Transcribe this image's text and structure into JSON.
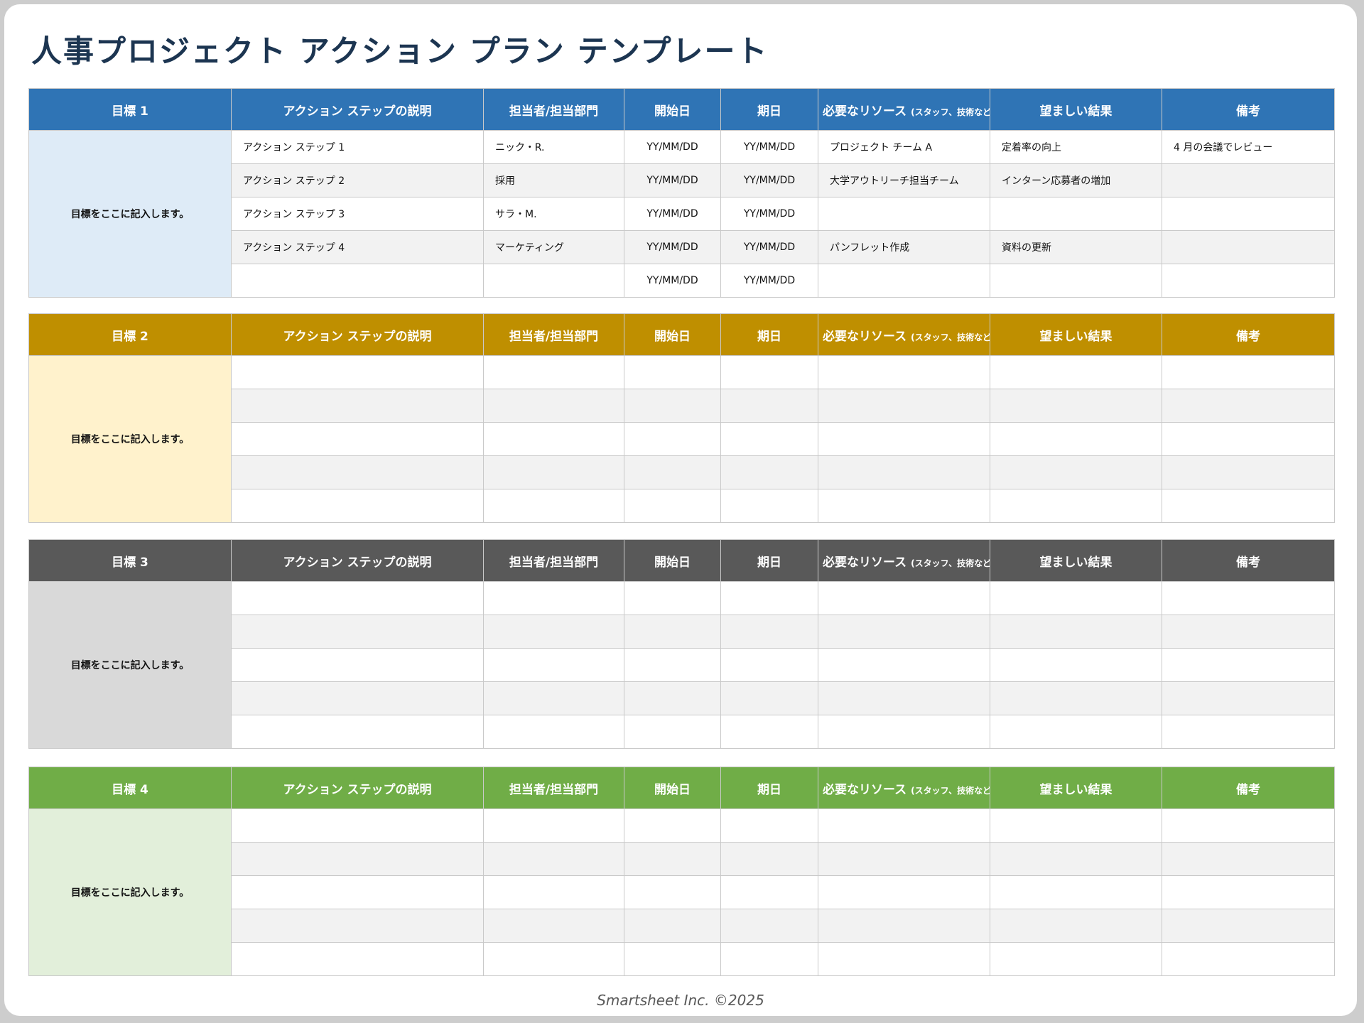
{
  "title": "人事プロジェクト アクション プラン テンプレート",
  "colors": {
    "goal1_header": "#2f74b5",
    "goal1_cell": "#deebf7",
    "goal2_header": "#bf8f00",
    "goal2_cell": "#fff2cc",
    "goal3_header": "#595959",
    "goal3_cell": "#d9d9d9",
    "goal4_header": "#70ad47",
    "goal4_cell": "#e2efda"
  },
  "headers": {
    "description": "アクション ステップの説明",
    "owner": "担当者/担当部門",
    "start": "開始日",
    "due": "期日",
    "resources": "必要なリソース",
    "resources_note": "(スタッフ、技術など)",
    "outcome": "望ましい結果",
    "notes": "備考"
  },
  "goals": [
    {
      "label": "目標 1",
      "text": "目標をここに記入します。",
      "rows": [
        {
          "description": "アクション ステップ 1",
          "owner": "ニック・R.",
          "start": "YY/MM/DD",
          "due": "YY/MM/DD",
          "resources": "プロジェクト チーム A",
          "outcome": "定着率の向上",
          "notes": "4 月の会議でレビュー"
        },
        {
          "description": "アクション ステップ 2",
          "owner": "採用",
          "start": "YY/MM/DD",
          "due": "YY/MM/DD",
          "resources": "大学アウトリーチ担当チーム",
          "outcome": "インターン応募者の増加",
          "notes": ""
        },
        {
          "description": "アクション ステップ 3",
          "owner": "サラ・M.",
          "start": "YY/MM/DD",
          "due": "YY/MM/DD",
          "resources": "",
          "outcome": "",
          "notes": ""
        },
        {
          "description": "アクション ステップ 4",
          "owner": "マーケティング",
          "start": "YY/MM/DD",
          "due": "YY/MM/DD",
          "resources": "パンフレット作成",
          "outcome": "資料の更新",
          "notes": ""
        },
        {
          "description": "",
          "owner": "",
          "start": "YY/MM/DD",
          "due": "YY/MM/DD",
          "resources": "",
          "outcome": "",
          "notes": ""
        }
      ]
    },
    {
      "label": "目標 2",
      "text": "目標をここに記入します。",
      "rows": [
        {
          "description": "",
          "owner": "",
          "start": "",
          "due": "",
          "resources": "",
          "outcome": "",
          "notes": ""
        },
        {
          "description": "",
          "owner": "",
          "start": "",
          "due": "",
          "resources": "",
          "outcome": "",
          "notes": ""
        },
        {
          "description": "",
          "owner": "",
          "start": "",
          "due": "",
          "resources": "",
          "outcome": "",
          "notes": ""
        },
        {
          "description": "",
          "owner": "",
          "start": "",
          "due": "",
          "resources": "",
          "outcome": "",
          "notes": ""
        },
        {
          "description": "",
          "owner": "",
          "start": "",
          "due": "",
          "resources": "",
          "outcome": "",
          "notes": ""
        }
      ]
    },
    {
      "label": "目標 3",
      "text": "目標をここに記入します。",
      "rows": [
        {
          "description": "",
          "owner": "",
          "start": "",
          "due": "",
          "resources": "",
          "outcome": "",
          "notes": ""
        },
        {
          "description": "",
          "owner": "",
          "start": "",
          "due": "",
          "resources": "",
          "outcome": "",
          "notes": ""
        },
        {
          "description": "",
          "owner": "",
          "start": "",
          "due": "",
          "resources": "",
          "outcome": "",
          "notes": ""
        },
        {
          "description": "",
          "owner": "",
          "start": "",
          "due": "",
          "resources": "",
          "outcome": "",
          "notes": ""
        },
        {
          "description": "",
          "owner": "",
          "start": "",
          "due": "",
          "resources": "",
          "outcome": "",
          "notes": ""
        }
      ]
    },
    {
      "label": "目標 4",
      "text": "目標をここに記入します。",
      "rows": [
        {
          "description": "",
          "owner": "",
          "start": "",
          "due": "",
          "resources": "",
          "outcome": "",
          "notes": ""
        },
        {
          "description": "",
          "owner": "",
          "start": "",
          "due": "",
          "resources": "",
          "outcome": "",
          "notes": ""
        },
        {
          "description": "",
          "owner": "",
          "start": "",
          "due": "",
          "resources": "",
          "outcome": "",
          "notes": ""
        },
        {
          "description": "",
          "owner": "",
          "start": "",
          "due": "",
          "resources": "",
          "outcome": "",
          "notes": ""
        },
        {
          "description": "",
          "owner": "",
          "start": "",
          "due": "",
          "resources": "",
          "outcome": "",
          "notes": ""
        }
      ]
    }
  ],
  "footer": "Smartsheet Inc. ©2025"
}
